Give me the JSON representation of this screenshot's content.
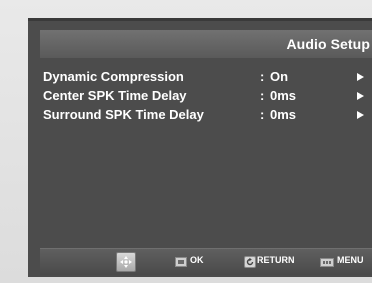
{
  "screen": {
    "title": "Audio Setup"
  },
  "menu": {
    "items": [
      {
        "label": "Dynamic Compression",
        "colon": ":",
        "value": "On"
      },
      {
        "label": "Center SPK Time Delay",
        "colon": ":",
        "value": "0ms"
      },
      {
        "label": "Surround SPK Time Delay",
        "colon": ":",
        "value": "0ms"
      }
    ]
  },
  "nav": {
    "ok_label": "OK",
    "return_label": "RETURN",
    "menu_label": "MENU",
    "icons": [
      "dpad-icon",
      "ok-icon",
      "return-icon",
      "menu-icon"
    ]
  },
  "colors": {
    "screen_bg": "#4c4c4c",
    "title_bar": "#646464",
    "text": "#ffffff",
    "frame": "#e3e3e3"
  }
}
